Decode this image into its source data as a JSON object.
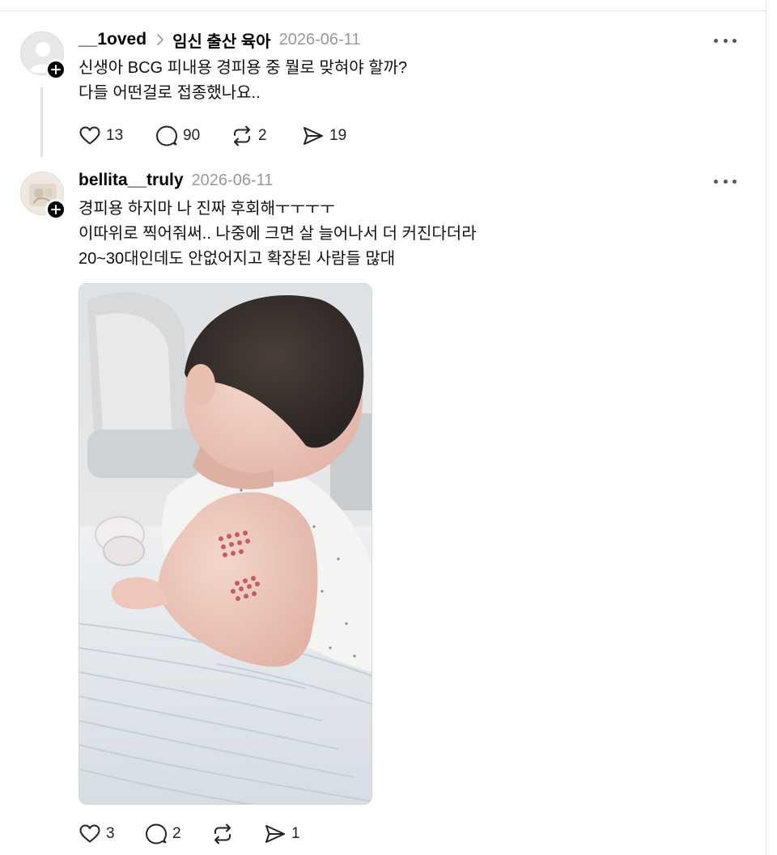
{
  "posts": [
    {
      "username": "__1oved",
      "topic": "임신 출산 육아",
      "date": "2026-06-11",
      "lines": [
        "신생아 BCG 피내용 경피용 중 뭘로 맞혀야 할까?",
        "다들 어떤걸로 접종했나요.."
      ],
      "likes": "13",
      "replies": "90",
      "reposts": "2",
      "shares": "19"
    },
    {
      "username": "bellita__truly",
      "date": "2026-06-11",
      "lines": [
        "경피용 하지마 나 진짜 후회해ㅜㅜㅜㅜ",
        "이따위로 찍어줘써.. 나중에 크면 살 늘어나서 더 커진다더라",
        "20~30대인데도 안없어지고 확장된 사람들 많대"
      ],
      "likes": "3",
      "replies": "2",
      "reposts": "",
      "shares": "1"
    }
  ],
  "icons": {
    "more": "more-horizontal-icon",
    "like": "heart-icon",
    "reply": "comment-icon",
    "repost": "repost-icon",
    "share": "send-icon",
    "follow": "plus-icon",
    "chevron": "chevron-right-icon"
  },
  "colors": {
    "text": "#000000",
    "muted": "#999999",
    "border": "#e5e5e5"
  }
}
